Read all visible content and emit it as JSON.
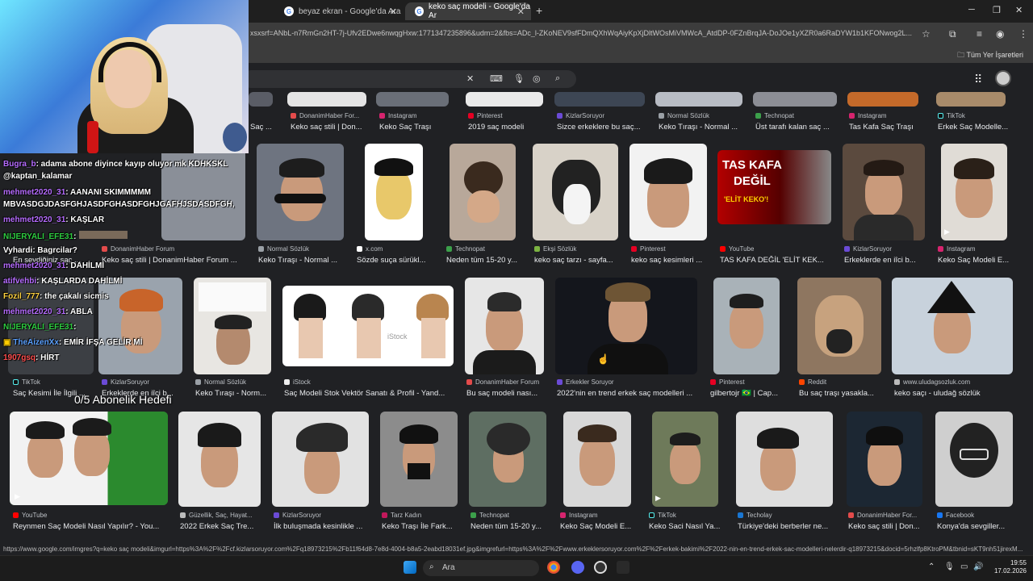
{
  "browser": {
    "tabs": [
      {
        "label": "beyaz ekran - Google'da Ara",
        "active": false
      },
      {
        "label": "keko saç modeli - Google'da Ar",
        "active": true
      }
    ],
    "url": "xsxsrf=ANbL-n7RmGn2HT-7j-Ufv2EDwe6nwqgHxw:1771347235896&udm=2&fbs=ADc_l-ZKoNEV9sfFDmQXhWqAiyKpXjDltWOsMiVMWcA_AtdDP-0FZnBrqJA-DoJOe1yXZR0a6RaDYW1b1KFONwog2L...",
    "bookmarks_all": "Tüm Yer İşaretleri",
    "status_url": "https://www.google.com/imgres?q=keko saç modeli&imgurl=https%3A%2F%2Fcf.kizlarsoruyor.com%2Fq18973215%2Fb11f64d8-7e8d-4004-b8a5-2eabd18031ef.jpg&imgrefurl=https%3A%2F%2Fwww.erkeklersoruyor.com%2F%2Ferkek-bakimi%2F2022-nin-en-trend-erkek-sac-modelleri-nelerdir-q18973215&docid=5rhzlfp8KtroPM&tbnid=sKT9nh51jirexM..."
  },
  "results": {
    "row0": [
      {
        "source": "DonanimHaber For...",
        "caption": "Keko saç stili | Don..."
      },
      {
        "source": "Instagram",
        "caption": "Keko Saç Traşı"
      },
      {
        "source": "Pinterest",
        "caption": "2019 saç modeli"
      },
      {
        "source": "KizlarSoruyor",
        "caption": "Sizce erkeklere bu saç..."
      },
      {
        "source": "Normal Sözlük",
        "caption": "Keko Tıraşı - Normal ..."
      },
      {
        "source": "Technopat",
        "caption": "Üst tarafı kalan saç ..."
      },
      {
        "source": "Instagram",
        "caption": "Tas Kafa Saç Traşı"
      },
      {
        "source": "TikTok",
        "caption": "Erkek Saç Modelle..."
      }
    ],
    "row0_partial_caption": "Saç ...",
    "row1": [
      {
        "source": "DonanimHaber Forum",
        "caption": "Keko saç stili | DonanimHaber Forum ..."
      },
      {
        "source": "Normal Sözlük",
        "caption": "Keko Tıraşı - Normal ..."
      },
      {
        "source": "x.com",
        "caption": "Sözde suça sürükl..."
      },
      {
        "source": "Technopat",
        "caption": "Neden tüm 15-20 y..."
      },
      {
        "source": "Ekşi Sözlük",
        "caption": "keko saç tarzı - sayfa..."
      },
      {
        "source": "Pinterest",
        "caption": "keko saç kesimleri ..."
      },
      {
        "source": "YouTube",
        "caption": "TAS KAFA DEĞİL 'ELİT KEK..."
      },
      {
        "source": "KizlarSoruyor",
        "caption": "Erkeklerde en iîci b..."
      },
      {
        "source": "Instagram",
        "caption": "Keko Saç Modeli E..."
      }
    ],
    "row1_partial_caption": "En sevdiğiniz saç ...",
    "thumb_text": {
      "tas_kafa": "TAS KAFA",
      "degil": "DEĞİL",
      "elit": "'ELİT KEKO'!",
      "istock": "iStock"
    },
    "row2": [
      {
        "source": "TikTok",
        "caption": "Saç Kesimi İle İlgili ..."
      },
      {
        "source": "KizlarSoruyor",
        "caption": "Erkeklerde en iîci b..."
      },
      {
        "source": "Normal Sözlük",
        "caption": "Keko Tıraşı - Norm..."
      },
      {
        "source": "iStock",
        "caption": "Saç Modeli Stok Vektör Sanatı & Profil - Yand..."
      },
      {
        "source": "DonanimHaber Forum",
        "caption": "Bu saç modeli nası..."
      },
      {
        "source": "Erkekler Soruyor",
        "caption": "2022'nin en trend erkek saç modelleri ..."
      },
      {
        "source": "Pinterest",
        "caption": "gilbertojr 🇧🇷 | Cap..."
      },
      {
        "source": "Reddit",
        "caption": "Bu saç traşı yasakla..."
      },
      {
        "source": "www.uludagsozluk.com",
        "caption": "keko saçı - uludağ sözlük"
      }
    ],
    "row3": [
      {
        "source": "YouTube",
        "caption": "Reynmen Saç Modeli Nasıl Yapılır? - You..."
      },
      {
        "source": "Güzellik, Saç, Hayat...",
        "caption": "2022 Erkek Saç Tre..."
      },
      {
        "source": "KizlarSoruyor",
        "caption": "İlk buluşmada kesinlikle ..."
      },
      {
        "source": "Tarz Kadın",
        "caption": "Keko Traşı İle Fark..."
      },
      {
        "source": "Technopat",
        "caption": "Neden tüm 15-20 y..."
      },
      {
        "source": "Instagram",
        "caption": "Keko Saç Modeli E..."
      },
      {
        "source": "TikTok",
        "caption": "Keko Saci Nasıl Ya..."
      },
      {
        "source": "Techolay",
        "caption": "Türkiye'deki berberler ne..."
      },
      {
        "source": "DonanimHaber For...",
        "caption": "Keko saç stili | Don..."
      },
      {
        "source": "Facebook",
        "caption": "Konya'da sevgiller..."
      }
    ]
  },
  "stream": {
    "chat": [
      {
        "user": "Bugra_b",
        "msg": ": adama abone diyince kayıp oluyor mk KDHKSKL"
      },
      {
        "user": "",
        "msg": "@kaptan_kalamar"
      },
      {
        "user": "mehmet2020_31",
        "msg": ": AANANI SKIMMMMM"
      },
      {
        "user": "",
        "msg": "MBVASDGJDASFGHJASDFGHASDFGHJGAFHJSDASDFGH,"
      },
      {
        "user": "mehmet2020_31",
        "msg": ": KAŞLAR"
      },
      {
        "user": "NIJERYALI_EFE31",
        "msg": ":"
      },
      {
        "user": "Vyhardi",
        "msg": ": Bagrcilar?"
      },
      {
        "user": "mehmet2020_31",
        "msg": ": DAHİLMİ"
      },
      {
        "user": "atifvehbi",
        "msg": ": KAŞLARDA DAHİLMİ"
      },
      {
        "user": "Fozil_777",
        "msg": ": the çakalı sicmis"
      },
      {
        "user": "mehmet2020_31",
        "msg": ": ABLA"
      },
      {
        "user": "NIJERYALI_EFE31",
        "msg": ":"
      },
      {
        "user": "TheAizenXx",
        "msg": ": EMİR İFŞA GELİR Mİ"
      },
      {
        "user": "1907gsq",
        "msg": ": HİRT"
      }
    ],
    "goal": "0/5 Abonelik Hedefi"
  },
  "taskbar": {
    "search": "Ara",
    "time": "19:55",
    "date": "17.02.2026"
  }
}
